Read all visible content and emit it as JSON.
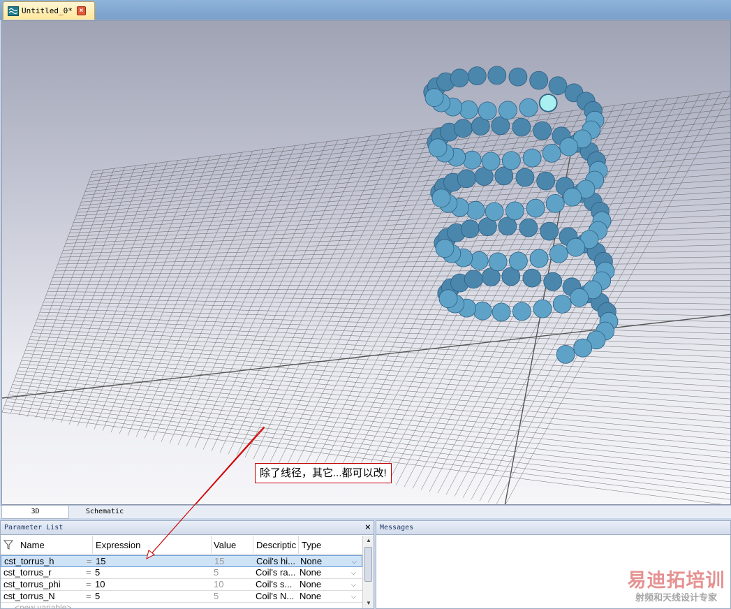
{
  "document_tab": {
    "title": "Untitled_0*",
    "icon": "app-wave-icon",
    "close_icon": "close-icon"
  },
  "annotation": {
    "text": "除了线径，其它...都可以改!",
    "color": "#c00000"
  },
  "view_tabs": {
    "tab_3d": "3D",
    "tab_schematic": "Schematic",
    "active": "3D"
  },
  "parameter_list": {
    "title": "Parameter List",
    "close_label": "×",
    "columns": {
      "name": "Name",
      "expression": "Expression",
      "value": "Value",
      "description": "Descriptic",
      "type": "Type"
    },
    "rows": [
      {
        "name": "cst_torrus_h",
        "eq": "=",
        "expression": "15",
        "value": "15",
        "description": "Coil's hi...",
        "type": "None",
        "selected": true
      },
      {
        "name": "cst_torrus_r",
        "eq": "=",
        "expression": "5",
        "value": "5",
        "description": "Coil's ra...",
        "type": "None"
      },
      {
        "name": "cst_torrus_phi",
        "eq": "=",
        "expression": "10",
        "value": "10",
        "description": "Coil's s...",
        "type": "None"
      },
      {
        "name": "cst_torrus_N",
        "eq": "=",
        "expression": "5",
        "value": "5",
        "description": "Coil's N...",
        "type": "None"
      }
    ],
    "new_row": "<new variable>"
  },
  "messages": {
    "title": "Messages"
  },
  "watermark": {
    "main": "易迪拓培训",
    "sub": "射频和天线设计专家"
  },
  "colors": {
    "coil": "#5fa2c8",
    "coil_dark": "#2c5f82",
    "coil_end": "#aaf0f0",
    "grid": "#3c3c3c"
  }
}
